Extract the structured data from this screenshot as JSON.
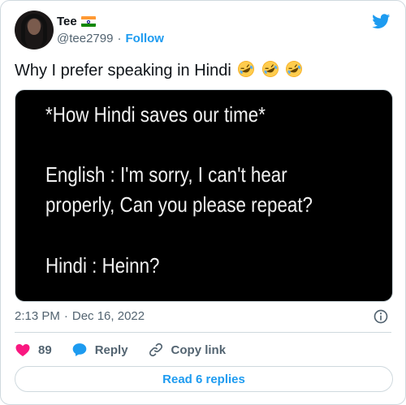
{
  "author": {
    "name": "Tee",
    "flag_emoji": "india-flag",
    "handle": "@tee2799",
    "separator": "·",
    "follow_label": "Follow"
  },
  "tweet": {
    "text": "Why I prefer speaking in Hindi",
    "emoji": [
      "rolling-on-floor-laughing",
      "rolling-on-floor-laughing",
      "rolling-on-floor-laughing"
    ]
  },
  "media": {
    "lines": [
      "*How Hindi saves our time*",
      "English : I'm sorry, I can't hear",
      "properly, Can you please repeat?",
      "Hindi : Heinn?"
    ]
  },
  "meta": {
    "time": "2:13 PM",
    "separator": "·",
    "date": "Dec 16, 2022"
  },
  "actions": {
    "like_count": "89",
    "reply_label": "Reply",
    "copy_link_label": "Copy link"
  },
  "read_replies_label": "Read 6 replies",
  "colors": {
    "twitter_blue": "#1d9bf0",
    "like_red": "#f91880",
    "text_primary": "#0f1419",
    "text_secondary": "#536471",
    "border": "#cfd9de"
  }
}
